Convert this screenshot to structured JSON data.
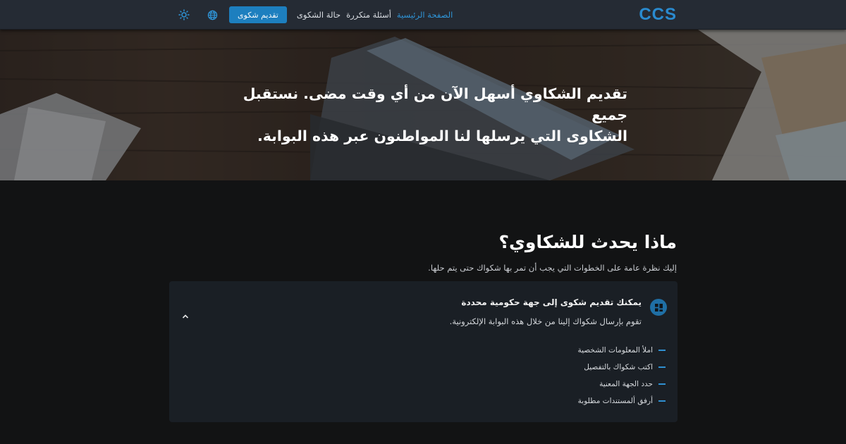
{
  "nav": {
    "logo": "CCS",
    "links": [
      {
        "label": "الصفحة الرئيسية",
        "active": true
      },
      {
        "label": "أسئلة متكررة",
        "active": false
      },
      {
        "label": "حالة الشكوى",
        "active": false
      }
    ],
    "submit_button": "تقديم شكوى",
    "icons": [
      "globe-icon",
      "sun-icon"
    ]
  },
  "hero": {
    "line1": "تقديم الشكاوي أسهل الآن من أي وقت مضى. نستقبل جميع",
    "line2": "الشكاوى التي يرسلها لنا المواطنون عبر هذه البوابة."
  },
  "section": {
    "title": "ماذا يحدث للشكاوي؟",
    "subtitle": "إليك نظرة عامة على الخطوات التي يجب أن تمر بها شكواك حتى يتم حلها."
  },
  "card": {
    "title": "يمكنك تقديم شكوى إلى جهة حكومية محددة",
    "description": "تقوم بإرسال شكواك إلينا من خلال هذه البوابة الإلكترونية.",
    "steps": [
      "املأ المعلومات الشخصية",
      "اكتب شكواك بالتفصيل",
      "حدد الجهة المعنية",
      "أرفق ألمستندات مطلوبة"
    ]
  },
  "colors": {
    "accent": "#1d7fbf",
    "background": "#121314",
    "navbar": "#252b34",
    "card": "#1a1f25"
  }
}
